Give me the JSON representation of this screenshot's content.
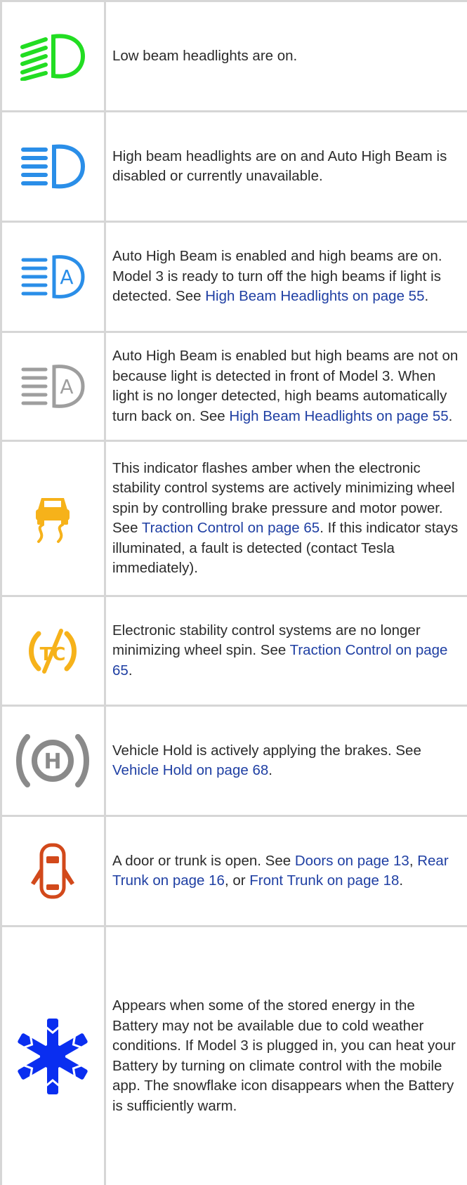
{
  "rows": [
    {
      "icon": "low-beam-headlights-icon",
      "color": "#22dd22",
      "text": [
        "Low beam headlights are on."
      ]
    },
    {
      "icon": "high-beam-headlights-icon",
      "color": "#2a8ee8",
      "text": [
        "High beam headlights are on and Auto High Beam is disabled or currently unavailable."
      ]
    },
    {
      "icon": "auto-high-beam-on-icon",
      "color": "#2a8ee8",
      "text": [
        "Auto High Beam is enabled and high beams are on. Model 3 is ready to turn off the high beams if light is detected. See ",
        "High Beam Headlights on page 55",
        "."
      ]
    },
    {
      "icon": "auto-high-beam-standby-icon",
      "color": "#9e9e9e",
      "text": [
        "Auto High Beam is enabled but high beams are not on because light is detected in front of Model 3. When light is no longer detected, high beams automatically turn back on. See ",
        "High Beam Headlights on page 55",
        "."
      ]
    },
    {
      "icon": "traction-control-icon",
      "color": "#f6b21a",
      "text": [
        "This indicator flashes amber when the electronic stability control systems are actively minimizing wheel spin by controlling brake pressure and motor power. See ",
        "Traction Control on page 65",
        ". If this indicator stays illuminated, a fault is detected (contact Tesla immediately)."
      ]
    },
    {
      "icon": "traction-control-off-icon",
      "color": "#f6b21a",
      "text": [
        "Electronic stability control systems are no longer minimizing wheel spin. See ",
        "Traction Control on page 65",
        "."
      ]
    },
    {
      "icon": "vehicle-hold-icon",
      "color": "#8a8a8a",
      "text": [
        "Vehicle Hold is actively applying the brakes. See ",
        "Vehicle Hold on page 68",
        "."
      ]
    },
    {
      "icon": "door-open-icon",
      "color": "#d2491b",
      "text": [
        "A door or trunk is open. See ",
        "Doors on page 13",
        ", ",
        "Rear Trunk on page 16",
        ", or ",
        "Front Trunk on page 18",
        "."
      ]
    },
    {
      "icon": "snowflake-icon",
      "color": "#0a2ef0",
      "text": [
        "Appears when some of the stored energy in the Battery may not be available due to cold weather conditions. If Model 3 is plugged in, you can heat your Battery by turning on climate control with the mobile app. The snowflake icon disappears when the Battery is sufficiently warm."
      ]
    }
  ]
}
